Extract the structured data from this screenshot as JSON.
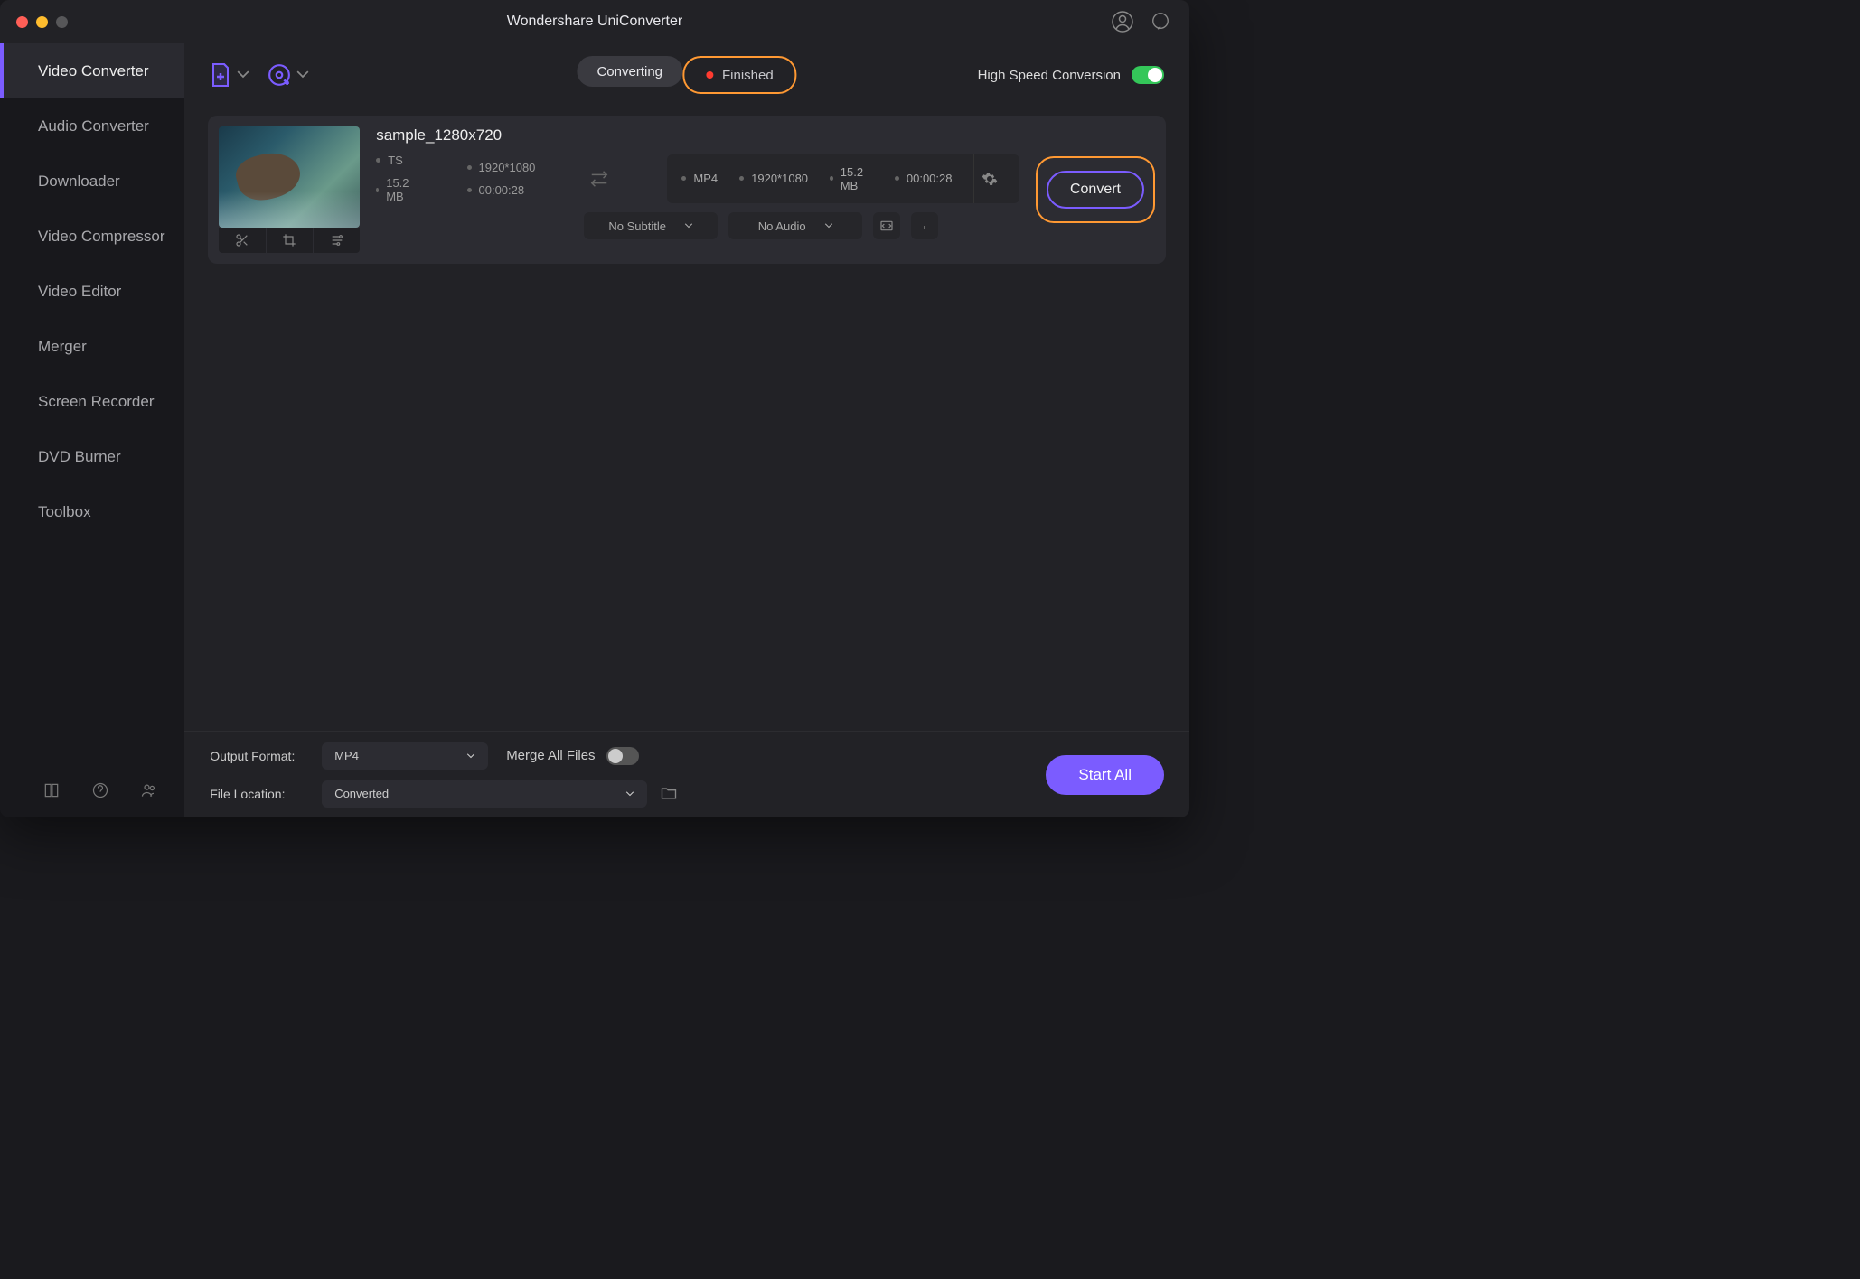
{
  "app_title": "Wondershare UniConverter",
  "sidebar": {
    "items": [
      {
        "label": "Video Converter",
        "active": true
      },
      {
        "label": "Audio Converter"
      },
      {
        "label": "Downloader"
      },
      {
        "label": "Video Compressor"
      },
      {
        "label": "Video Editor"
      },
      {
        "label": "Merger"
      },
      {
        "label": "Screen Recorder"
      },
      {
        "label": "DVD Burner"
      },
      {
        "label": "Toolbox"
      }
    ]
  },
  "toolbar": {
    "tabs": {
      "converting": "Converting",
      "finished": "Finished"
    },
    "hsc_label": "High Speed Conversion"
  },
  "file": {
    "name": "sample_1280x720",
    "source": {
      "format": "TS",
      "resolution": "1920*1080",
      "size": "15.2 MB",
      "duration": "00:00:28"
    },
    "output": {
      "format": "MP4",
      "resolution": "1920*1080",
      "size": "15.2 MB",
      "duration": "00:00:28"
    },
    "subtitle": "No Subtitle",
    "audio": "No Audio",
    "convert_label": "Convert"
  },
  "bottom": {
    "output_format_label": "Output Format:",
    "output_format_value": "MP4",
    "file_location_label": "File Location:",
    "file_location_value": "Converted",
    "merge_label": "Merge All Files",
    "start_label": "Start All"
  }
}
